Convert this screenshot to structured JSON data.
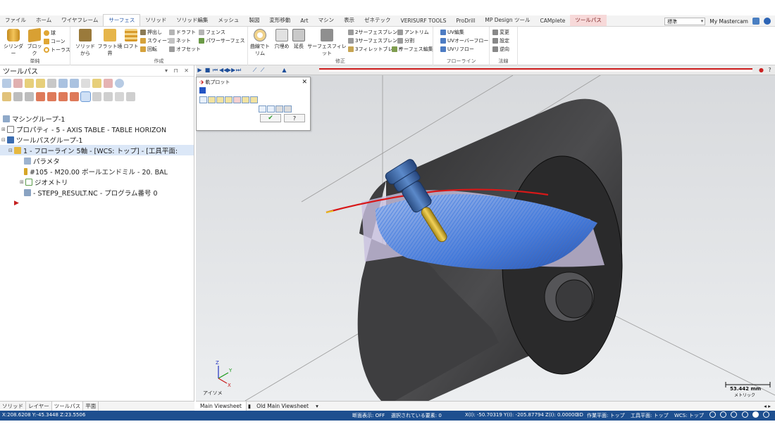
{
  "tabs": [
    {
      "label": "ファイル",
      "active": false
    },
    {
      "label": "ホーム",
      "active": false
    },
    {
      "label": "ワイヤフレーム",
      "active": false
    },
    {
      "label": "サーフェス",
      "active": true
    },
    {
      "label": "ソリッド",
      "active": false
    },
    {
      "label": "ソリッド編集",
      "active": false
    },
    {
      "label": "メッシュ",
      "active": false
    },
    {
      "label": "製図",
      "active": false
    },
    {
      "label": "変形移動",
      "active": false
    },
    {
      "label": "Art",
      "active": false
    },
    {
      "label": "マシン",
      "active": false
    },
    {
      "label": "表示",
      "active": false
    },
    {
      "label": "ゼネテック",
      "active": false
    },
    {
      "label": "VERISURF TOOLS",
      "active": false
    },
    {
      "label": "ProDrill",
      "active": false
    },
    {
      "label": "MP Design ツール",
      "active": false
    },
    {
      "label": "CAMplete",
      "active": false
    },
    {
      "label": "ツールパス",
      "active": false,
      "context": true
    }
  ],
  "topright": {
    "style_value": "標準",
    "my_mastercam": "My Mastercam"
  },
  "ribbon": {
    "groups": [
      {
        "label": "単純",
        "buttons": [
          "シリンダー",
          "ブロック"
        ],
        "small": [
          "球",
          "コーン",
          "トーラス"
        ]
      },
      {
        "label": "作成",
        "buttons": [
          "ソリッドから",
          "フラット境界",
          "ロフト"
        ],
        "small": [
          "押出し",
          "ドラフト",
          "フェンス",
          "スウィープ",
          "ネット",
          "パワーサーフェス",
          "回転",
          "オフセット"
        ]
      },
      {
        "label": "修正",
        "buttons": [
          "曲線でトリム",
          "穴埋め",
          "延長",
          "サーフェスフィレット"
        ],
        "small": [
          "2サーフェスブレンド",
          "アントリム",
          "3サーフェスブレンド",
          "分割",
          "3フィレットブレンド",
          "サーフェス編集"
        ]
      },
      {
        "label": "フローライン",
        "buttons": [],
        "small": [
          "UV編集",
          "UVオーバーフロー",
          "UVリフロー"
        ]
      },
      {
        "label": "法線",
        "buttons": [],
        "small": [
          "変更",
          "設定",
          "逆向"
        ]
      }
    ]
  },
  "left_panel": {
    "title": "ツールパス",
    "tree": [
      {
        "label": "マシングループ-1",
        "level": 0
      },
      {
        "label": "プロパティ - 5 - AXIS TABLE - TABLE HORIZON",
        "level": 1
      },
      {
        "label": "ツールパスグループ-1",
        "level": 1
      },
      {
        "label": "1 - フローライン 5軸 - [WCS: トップ] - [工具平面:",
        "level": 2
      },
      {
        "label": "パラメタ",
        "level": 3
      },
      {
        "label": "#105 - M20.00 ボールエンドミル -   20. BAL",
        "level": 3
      },
      {
        "label": "ジオメトリ",
        "level": 3
      },
      {
        "label": "- STEP9_RESULT.NC - プログラム番号 0",
        "level": 3
      }
    ]
  },
  "bottom_tabs": [
    "ソリッド",
    "レイヤー",
    "ツールパス",
    "平面"
  ],
  "backplot": {
    "title": "軌プロット",
    "ok": "✔",
    "help": "?"
  },
  "viewport": {
    "view_name": "アイソメ",
    "scale_value": "53.442 mm",
    "scale_unit": "メトリック",
    "axis_x": "X",
    "axis_y": "Y",
    "axis_z": "Z"
  },
  "viewsheets": [
    "Main Viewsheet",
    "Old Main Viewsheet"
  ],
  "status": {
    "coords_left": "X:208.6208  Y:-45.3448  Z:23.5506",
    "section": "断面表示: OFF",
    "selected": "選択されている要素: 0",
    "coords": "X(I): -50.70319   Y(I): -205.87794 Z(I): 0.00000",
    "mode": "3D",
    "cplane": "作業平面: トップ",
    "tplane": "工具平面: トップ",
    "wcs": "WCS: トップ"
  }
}
